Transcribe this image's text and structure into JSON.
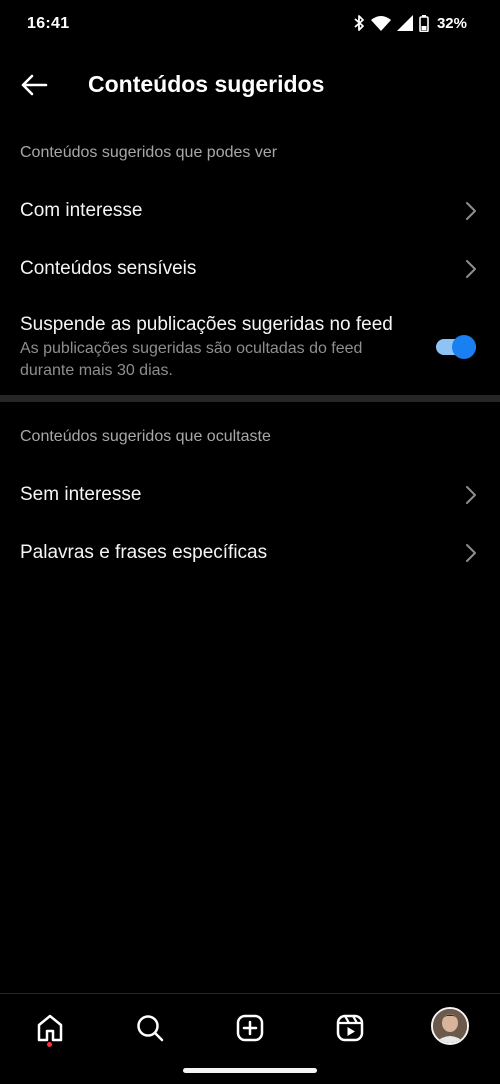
{
  "status_bar": {
    "time": "16:41",
    "battery": "32%",
    "icons": [
      "bluetooth-icon",
      "wifi-icon",
      "signal-icon",
      "battery-icon"
    ]
  },
  "header": {
    "back_icon": "arrow-left-icon",
    "title": "Conteúdos sugeridos"
  },
  "section_visible": {
    "header": "Conteúdos sugeridos que podes ver",
    "items": [
      {
        "label": "Com interesse"
      },
      {
        "label": "Conteúdos sensíveis"
      }
    ],
    "toggle_item": {
      "title": "Suspende as publicações sugeridas no feed",
      "description": "As publicações sugeridas são ocultadas do feed durante mais 30 dias.",
      "enabled": true,
      "accent_color": "#1a7ff0"
    }
  },
  "section_hidden": {
    "header": "Conteúdos sugeridos que ocultaste",
    "items": [
      {
        "label": "Sem interesse"
      },
      {
        "label": "Palavras e frases específicas"
      }
    ]
  },
  "bottom_nav": {
    "items": [
      "home-icon",
      "search-icon",
      "create-icon",
      "reels-icon",
      "profile-avatar"
    ],
    "active": "home-icon",
    "notification_color": "#ff3040"
  }
}
